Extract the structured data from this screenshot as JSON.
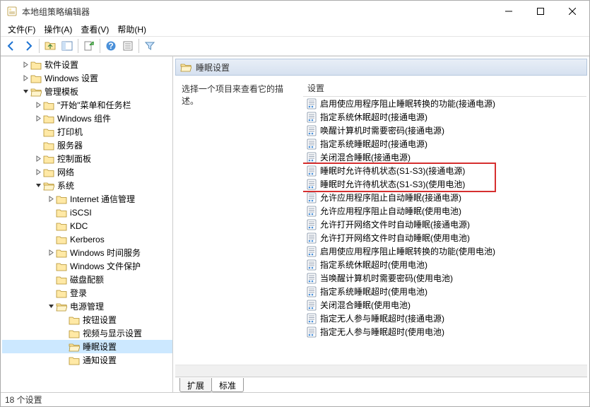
{
  "window": {
    "title": "本地组策略编辑器"
  },
  "menu": {
    "file": "文件(F)",
    "action": "操作(A)",
    "view": "查看(V)",
    "help": "帮助(H)"
  },
  "tree": {
    "software_settings": "软件设置",
    "windows_settings": "Windows 设置",
    "admin_templates": "管理模板",
    "start_taskbar": "\"开始\"菜单和任务栏",
    "windows_components": "Windows 组件",
    "printers": "打印机",
    "servers": "服务器",
    "control_panel": "控制面板",
    "network": "网络",
    "system": "系统",
    "internet_comm": "Internet 通信管理",
    "iscsi": "iSCSI",
    "kdc": "KDC",
    "kerberos": "Kerberos",
    "windows_time": "Windows 时间服务",
    "windows_file_protect": "Windows 文件保护",
    "disk_quota": "磁盘配额",
    "logon": "登录",
    "power_mgmt": "电源管理",
    "button_settings": "按钮设置",
    "video_display": "视频与显示设置",
    "sleep_settings": "睡眠设置",
    "notify_settings": "通知设置"
  },
  "right": {
    "header": "睡眠设置",
    "desc": "选择一个项目来查看它的描述。",
    "col_header": "设置",
    "items": [
      "启用使应用程序阻止睡眠转换的功能(接通电源)",
      "指定系统休眠超时(接通电源)",
      "唤醒计算机时需要密码(接通电源)",
      "指定系统睡眠超时(接通电源)",
      "关闭混合睡眠(接通电源)",
      "睡眠时允许待机状态(S1-S3)(接通电源)",
      "睡眠时允许待机状态(S1-S3)(使用电池)",
      "允许应用程序阻止自动睡眠(接通电源)",
      "允许应用程序阻止自动睡眠(使用电池)",
      "允许打开网络文件时自动睡眠(接通电源)",
      "允许打开网络文件时自动睡眠(使用电池)",
      "启用使应用程序阻止睡眠转换的功能(使用电池)",
      "指定系统休眠超时(使用电池)",
      "当唤醒计算机时需要密码(使用电池)",
      "指定系统睡眠超时(使用电池)",
      "关闭混合睡眠(使用电池)",
      "指定无人参与睡眠超时(接通电源)",
      "指定无人参与睡眠超时(使用电池)"
    ]
  },
  "tabs": {
    "extended": "扩展",
    "standard": "标准"
  },
  "status": "18 个设置"
}
